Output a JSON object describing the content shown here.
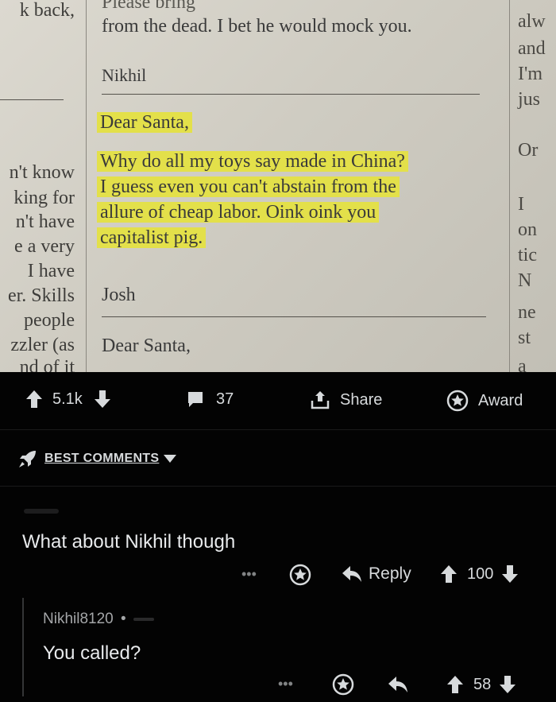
{
  "newspaper": {
    "top_line_partial": "Please bring",
    "line_from_dead": "from the dead. I bet he would mock you.",
    "sig_1": "Nikhil",
    "salutation_1": "Dear Santa,",
    "letter_lines": [
      "Why do all my toys say made in China?",
      "I guess even you can't abstain from the",
      "allure of cheap labor. Oink oink you",
      "capitalist pig."
    ],
    "sig_2": "Josh",
    "salutation_2": "Dear Santa,",
    "left_column": [
      "k back,",
      "n't know",
      "king for",
      "n't have",
      "e a very",
      "I have",
      "er. Skills",
      "people",
      "zzler (as",
      "nd of it"
    ],
    "right_column": [
      "alw",
      "and",
      "I'm",
      "jus",
      "Or",
      "I",
      "on",
      "tic",
      "N",
      "ne",
      "st",
      "a"
    ]
  },
  "post_actions": {
    "upvotes": "5.1k",
    "comments": "37",
    "share_label": "Share",
    "award_label": "Award"
  },
  "sort": {
    "label": "BEST COMMENTS"
  },
  "comments": [
    {
      "body": "What about Nikhil though",
      "more": "•••",
      "reply_label": "Reply",
      "score": "100"
    },
    {
      "author": "Nikhil8120",
      "separator": "•",
      "body": "You called?",
      "more": "•••",
      "score": "58"
    }
  ]
}
